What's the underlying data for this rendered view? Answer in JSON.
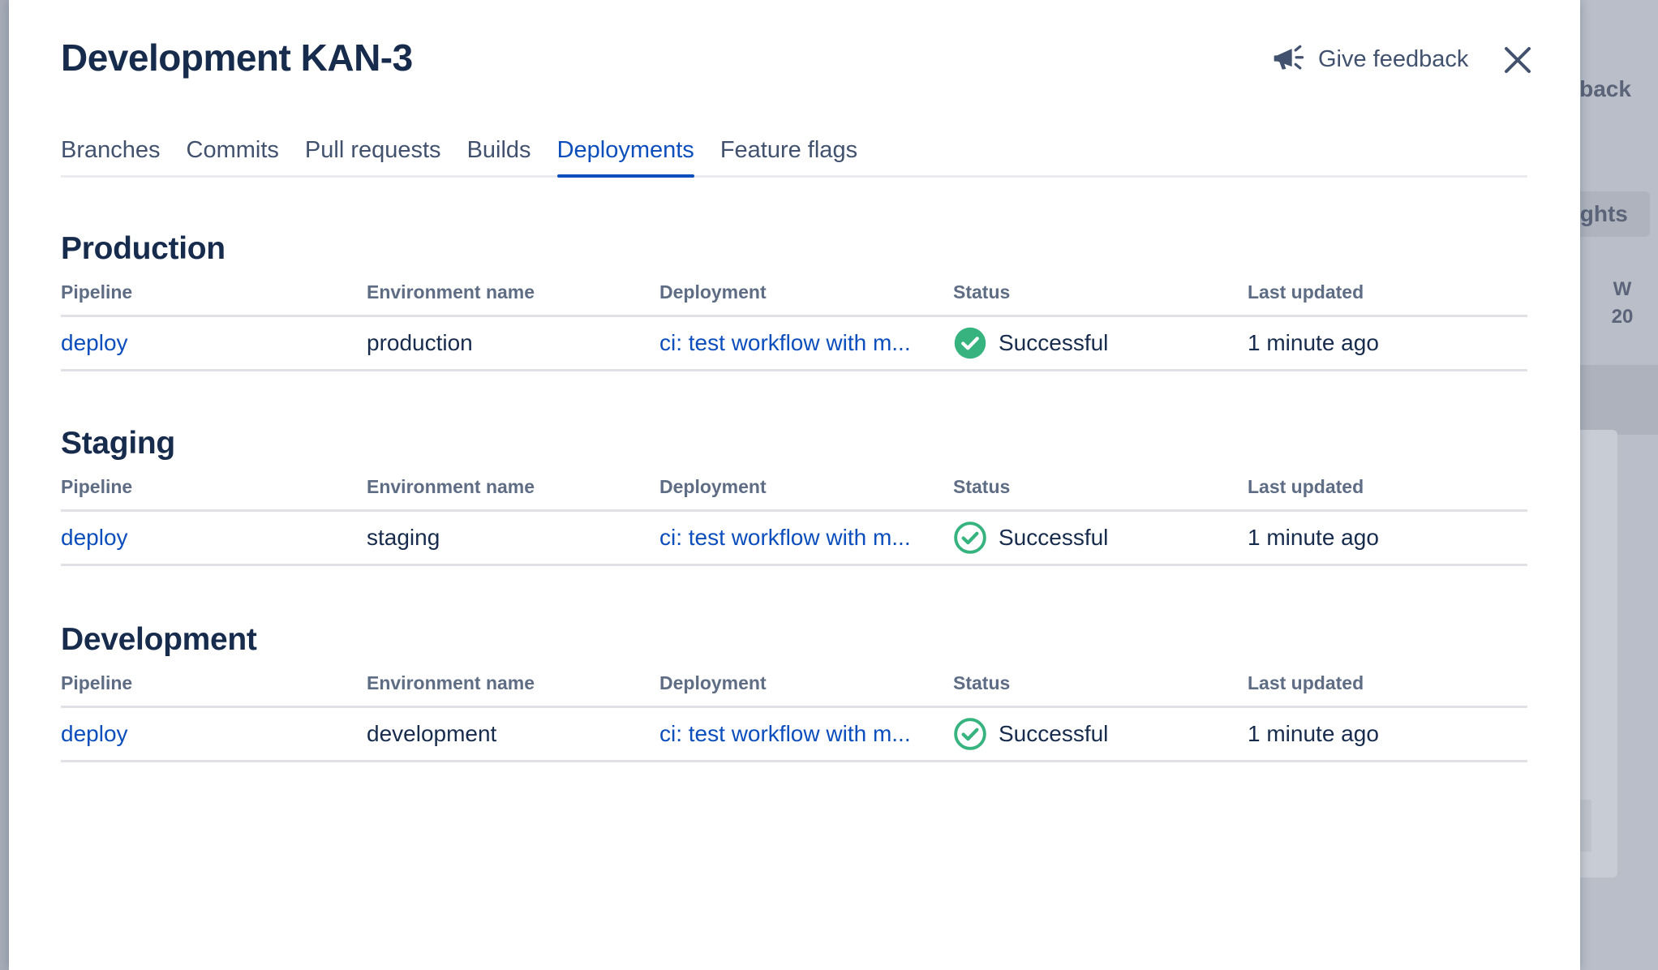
{
  "background": {
    "feedback_text": "dback",
    "insights_text": "ights",
    "week_label": "W",
    "week_number": "20"
  },
  "modal": {
    "title": "Development KAN-3",
    "feedback_label": "Give feedback",
    "tabs": [
      {
        "label": "Branches"
      },
      {
        "label": "Commits"
      },
      {
        "label": "Pull requests"
      },
      {
        "label": "Builds"
      },
      {
        "label": "Deployments",
        "active": true
      },
      {
        "label": "Feature flags"
      }
    ],
    "columns": {
      "pipeline": "Pipeline",
      "environment": "Environment name",
      "deployment": "Deployment",
      "status": "Status",
      "last_updated": "Last updated"
    },
    "sections": [
      {
        "title": "Production",
        "rows": [
          {
            "pipeline": "deploy",
            "environment": "production",
            "deployment": "ci: test workflow with m...",
            "status": "Successful",
            "last_updated": "1 minute ago",
            "status_icon": "check-filled"
          }
        ]
      },
      {
        "title": "Staging",
        "rows": [
          {
            "pipeline": "deploy",
            "environment": "staging",
            "deployment": "ci: test workflow with m...",
            "status": "Successful",
            "last_updated": "1 minute ago",
            "status_icon": "check-outline"
          }
        ]
      },
      {
        "title": "Development",
        "rows": [
          {
            "pipeline": "deploy",
            "environment": "development",
            "deployment": "ci: test workflow with m...",
            "status": "Successful",
            "last_updated": "1 minute ago",
            "status_icon": "check-outline"
          }
        ]
      }
    ]
  },
  "colors": {
    "link": "#0c4ebc",
    "success": "#36b37e",
    "heading": "#172b4d",
    "muted": "#5e6c84"
  }
}
